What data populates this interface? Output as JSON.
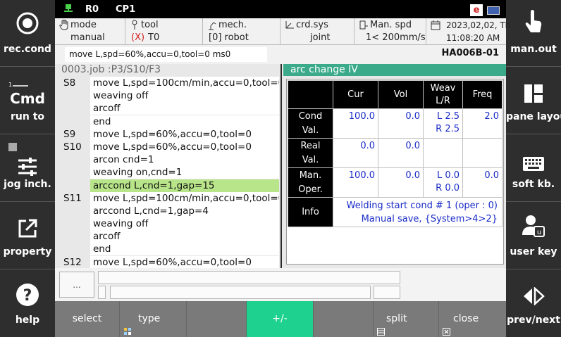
{
  "left_sidebar": {
    "rec_cond": "rec.cond",
    "cmd": "Cmd",
    "run_to": "run to",
    "jog_inch": "jog inch.",
    "property": "property",
    "help": "help"
  },
  "right_sidebar": {
    "man_out": "man.out",
    "pane_layout": "pane layout",
    "soft_kb": "soft kb.",
    "user_key": "user key",
    "prev_next": "prev/next"
  },
  "topbar": {
    "robot": "R0",
    "program": "CP1",
    "lang_badge": "e"
  },
  "infobar": {
    "mode": {
      "label": "mode",
      "value": "manual"
    },
    "tool": {
      "label": "tool",
      "prefix": "(X)",
      "value": "T0"
    },
    "mech": {
      "label": "mech.",
      "value": "[0] robot"
    },
    "crd": {
      "label": "crd.sys",
      "value": "joint"
    },
    "spd": {
      "label": "Man. spd",
      "value": "1< 200mm/s"
    },
    "datetime": {
      "date": "2023,02,02, Th",
      "time": "11:08:20 AM"
    }
  },
  "statusline": {
    "command": "move L,spd=60%,accu=0,tool=0 ms0",
    "robot_id": "HA006B-01"
  },
  "job": {
    "header": "0003.job :P3/S10/F3",
    "lines": [
      {
        "step": "S8",
        "code": "move L,spd=100cm/min,accu=0,tool=0"
      },
      {
        "step": "",
        "code": "weaving off"
      },
      {
        "step": "",
        "code": "arcoff"
      },
      {
        "step": "",
        "code": "end"
      },
      {
        "step": "S9",
        "code": "move L,spd=60%,accu=0,tool=0"
      },
      {
        "step": "S10",
        "code": "move L,spd=60%,accu=0,tool=0"
      },
      {
        "step": "",
        "code": "arcon cnd=1"
      },
      {
        "step": "",
        "code": "weaving on,cnd=1"
      },
      {
        "step": "",
        "code": "arccond L,cnd=1,gap=15"
      },
      {
        "step": "S11",
        "code": "move L,spd=100cm/min,accu=0,tool=0"
      },
      {
        "step": "",
        "code": "arccond L,cnd=1,gap=4"
      },
      {
        "step": "",
        "code": "weaving off"
      },
      {
        "step": "",
        "code": "arcoff"
      },
      {
        "step": "",
        "code": "end"
      },
      {
        "step": "S12",
        "code": "move L,spd=60%,accu=0,tool=0"
      }
    ]
  },
  "arc": {
    "title": "arc change IV",
    "headers": {
      "cur": "Cur",
      "vol": "Vol",
      "weav_1": "Weav",
      "weav_2": "L/R",
      "freq": "Freq"
    },
    "rows": {
      "cond": {
        "h1": "Cond",
        "h2": "Val.",
        "cur": "100.0",
        "vol": "0.0",
        "weav_l": "L 2.5",
        "weav_r": "R 2.5",
        "freq": "2.0"
      },
      "real": {
        "h1": "Real",
        "h2": "Val.",
        "cur": "0.0",
        "vol": "0.0"
      },
      "man": {
        "h1": "Man.",
        "h2": "Oper.",
        "cur": "100.0",
        "vol": "0.0",
        "weav_l": "L 0.0",
        "weav_r": "R 0.0",
        "freq": "0.0"
      },
      "info": {
        "h": "Info",
        "line1": "Welding start cond # 1 (oper : 0)",
        "line2": "Manual save, {System>4>2}"
      }
    }
  },
  "lower": {
    "ellipsis": "..."
  },
  "bottombar": {
    "select": "select",
    "type": "type",
    "plusminus": "+/-",
    "split": "split",
    "close": "close"
  },
  "colors": {
    "accent_green": "#1fd18f",
    "highlight_line": "#b8e58a",
    "arc_header": "#3aaa8a",
    "value_blue": "#1a2cc8"
  }
}
